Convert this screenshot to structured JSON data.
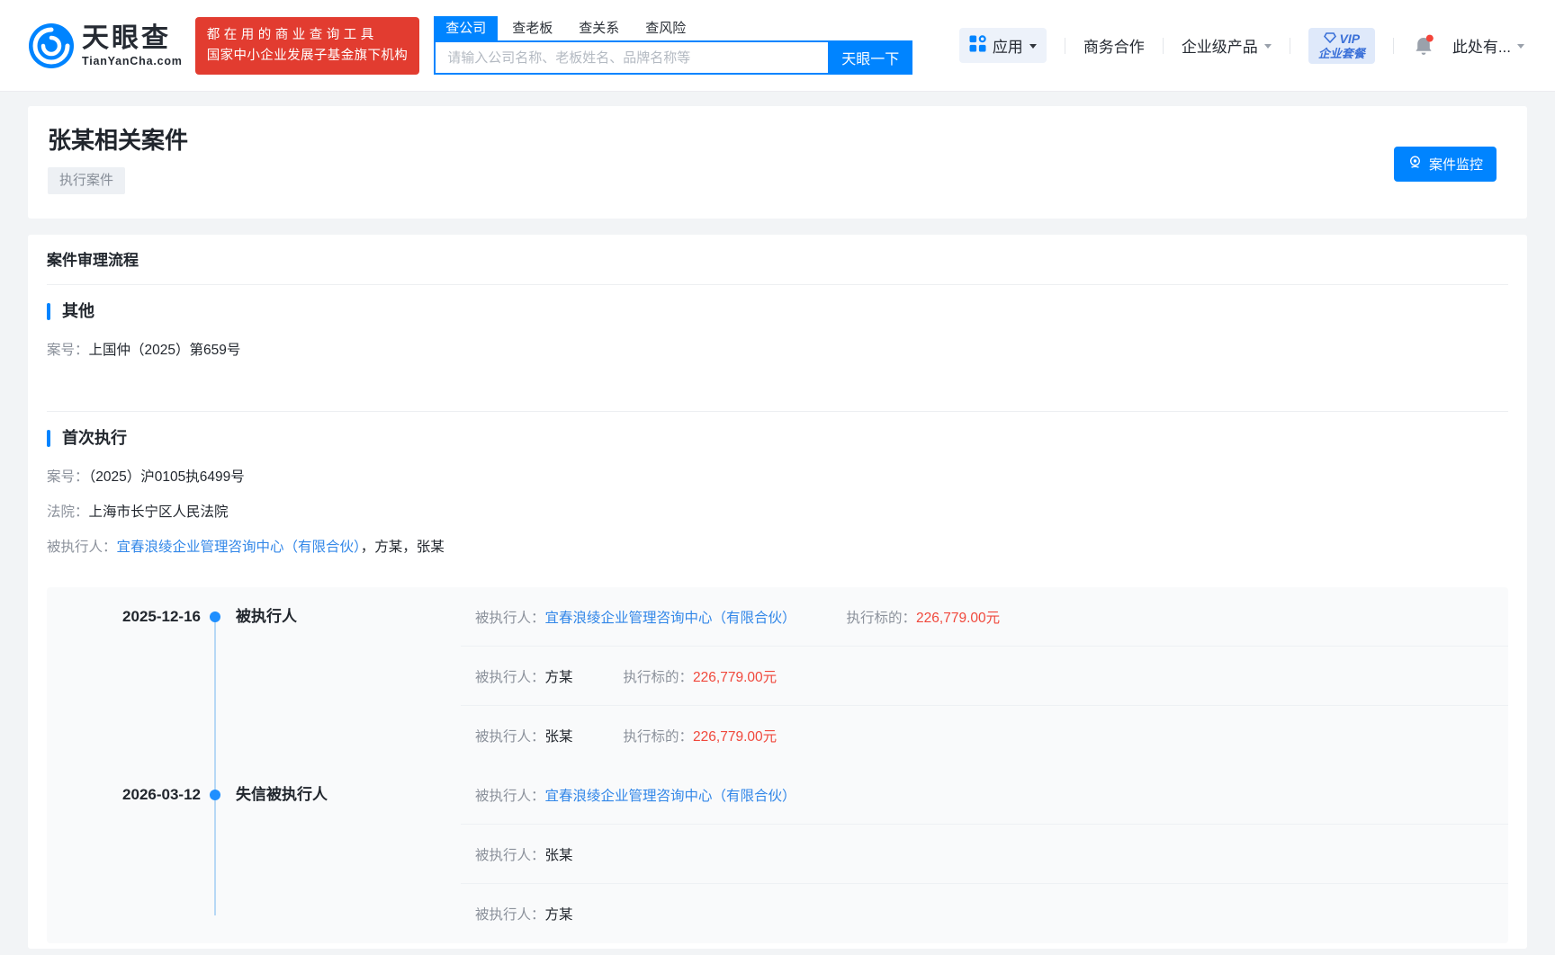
{
  "colors": {
    "brand_blue": "#0084ff",
    "banner_red": "#e23c30",
    "link_blue": "#3287e8",
    "money_red": "#f0483c",
    "timeline_dot": "#1f8fff"
  },
  "header": {
    "logo": {
      "brand_cn": "天眼查",
      "brand_en": "TianYanCha.com"
    },
    "banner": {
      "line1": "都在用的商业查询工具",
      "line2": "国家中小企业发展子基金旗下机构"
    },
    "search": {
      "tabs": [
        {
          "label": "查公司",
          "active": true
        },
        {
          "label": "查老板",
          "active": false
        },
        {
          "label": "查关系",
          "active": false
        },
        {
          "label": "查风险",
          "active": false
        }
      ],
      "placeholder": "请输入公司名称、老板姓名、品牌名称等",
      "button": "天眼一下"
    },
    "nav": {
      "apps": "应用",
      "biz": "商务合作",
      "enterprise": "企业级产品",
      "vip_line1": "VIP",
      "vip_line2": "企业套餐",
      "user": "此处有..."
    }
  },
  "title_card": {
    "title": "张某相关案件",
    "tag": "执行案件",
    "monitor_button": "案件监控"
  },
  "case_flow": {
    "section_header": "案件审理流程",
    "groups": [
      {
        "name": "其他",
        "fields": [
          {
            "parts": [
              {
                "type": "label",
                "text": "案号："
              },
              {
                "type": "text",
                "text": "上国仲（2025）第659号"
              }
            ]
          }
        ]
      },
      {
        "name": "首次执行",
        "fields": [
          {
            "parts": [
              {
                "type": "label",
                "text": "案号："
              },
              {
                "type": "text",
                "text": "（2025）沪0105执6499号"
              }
            ]
          },
          {
            "parts": [
              {
                "type": "label",
                "text": "法院："
              },
              {
                "type": "text",
                "text": "上海市长宁区人民法院"
              }
            ]
          },
          {
            "parts": [
              {
                "type": "label",
                "text": "被执行人："
              },
              {
                "type": "link",
                "text": "宜春浪绫企业管理咨询中心（有限合伙）"
              },
              {
                "type": "text",
                "text": "，方某，张某"
              }
            ]
          }
        ]
      }
    ],
    "timeline": [
      {
        "date": "2025-12-16",
        "event": "被执行人",
        "rows": [
          {
            "label": "被执行人：",
            "name": "宜春浪绫企业管理咨询中心（有限合伙）",
            "link": true,
            "amount_label": "执行标的：",
            "amount": "226,779.00元"
          },
          {
            "label": "被执行人：",
            "name": "方某",
            "link": false,
            "amount_label": "执行标的：",
            "amount": "226,779.00元"
          },
          {
            "label": "被执行人：",
            "name": "张某",
            "link": false,
            "amount_label": "执行标的：",
            "amount": "226,779.00元"
          }
        ]
      },
      {
        "date": "2026-03-12",
        "event": "失信被执行人",
        "rows": [
          {
            "label": "被执行人：",
            "name": "宜春浪绫企业管理咨询中心（有限合伙）",
            "link": true
          },
          {
            "label": "被执行人：",
            "name": "张某",
            "link": false
          },
          {
            "label": "被执行人：",
            "name": "方某",
            "link": false
          }
        ]
      }
    ]
  }
}
